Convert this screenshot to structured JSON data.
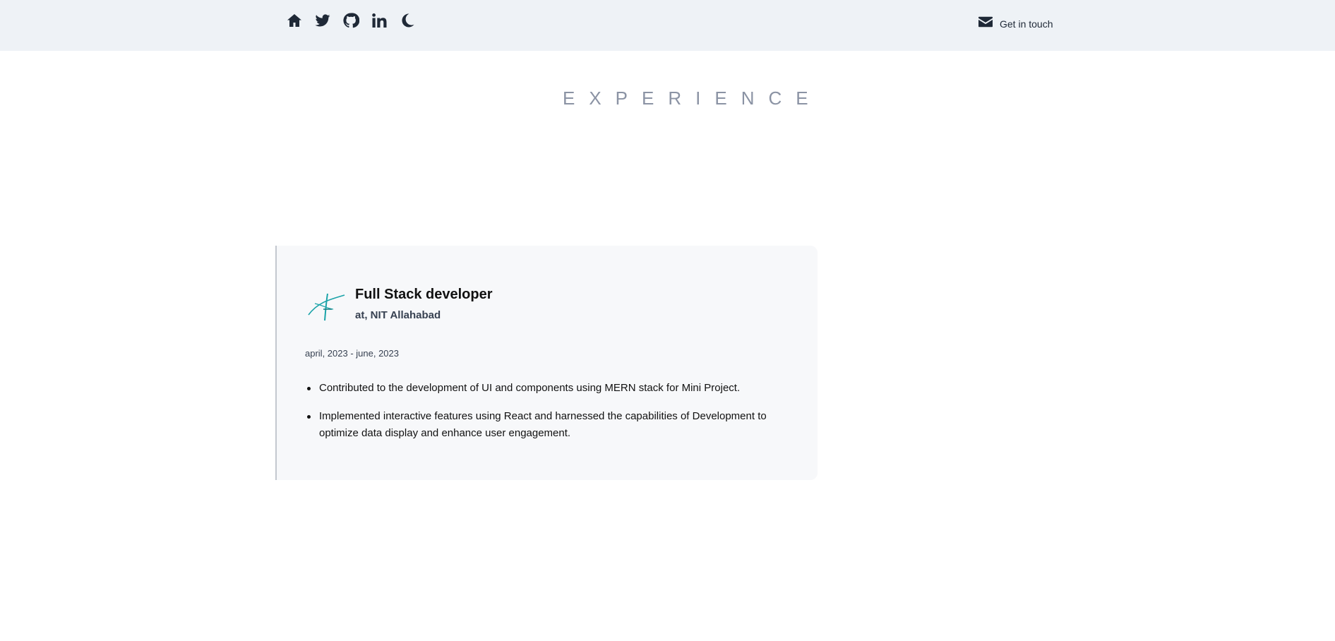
{
  "header": {
    "icons": [
      "home-icon",
      "twitter-icon",
      "github-icon",
      "linkedin-icon",
      "moon-icon"
    ],
    "contact_icon": "mail-icon",
    "contact_label": "Get in touch"
  },
  "section": {
    "title": "EXPERIENCE"
  },
  "experience": {
    "role": "Full Stack developer",
    "company": "at, NIT Allahabad",
    "dates": "april, 2023 - june, 2023",
    "logo": "company-logo",
    "bullets": [
      "Contributed to the development of UI and components using MERN stack for Mini Project.",
      "Implemented interactive features using React and harnessed the capabilities of Development to optimize data display and enhance user engagement."
    ]
  },
  "colors": {
    "header_bg": "#eef2f6",
    "card_bg": "#f7f8fa",
    "title": "#8b93a4",
    "logo_teal": "#1aa3a8"
  }
}
